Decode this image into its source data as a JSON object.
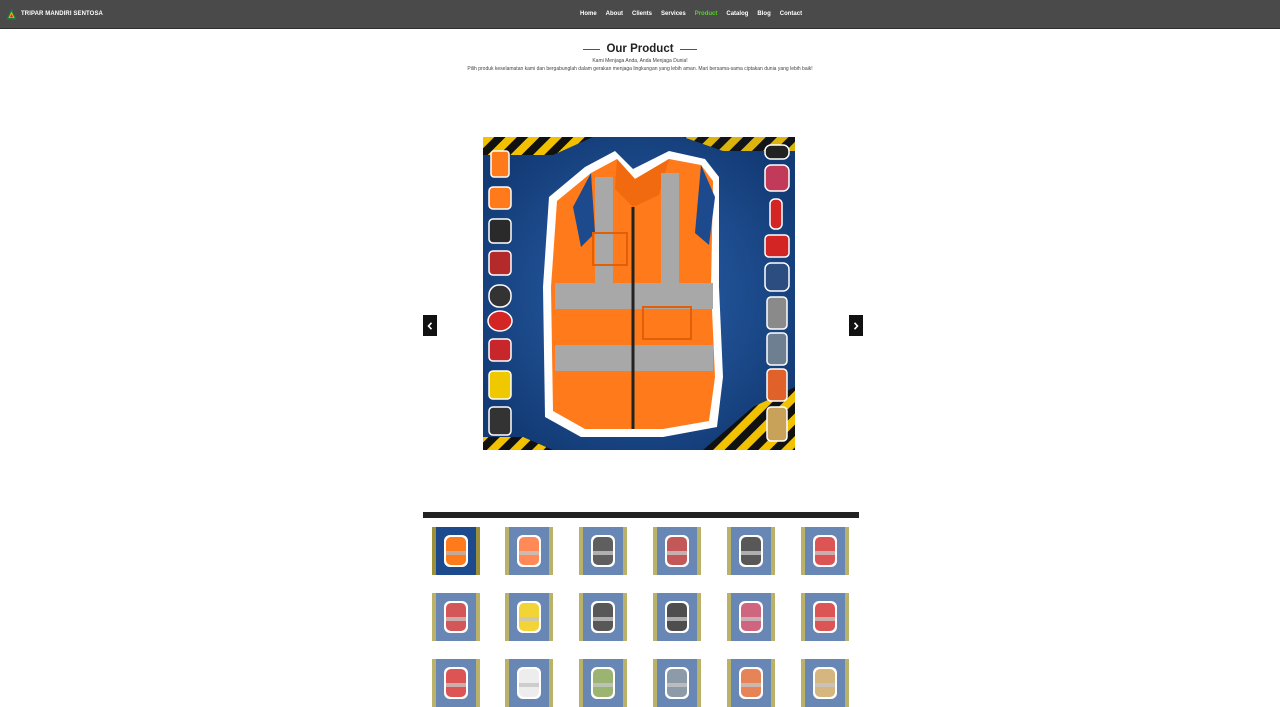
{
  "header": {
    "brand": "TRIPAR MANDIRI SENTOSA",
    "logo_icon": "triangle-logo-icon",
    "nav": [
      {
        "label": "Home",
        "active": false
      },
      {
        "label": "About",
        "active": false
      },
      {
        "label": "Clients",
        "active": false
      },
      {
        "label": "Services",
        "active": false
      },
      {
        "label": "Product",
        "active": true
      },
      {
        "label": "Catalog",
        "active": false
      },
      {
        "label": "Blog",
        "active": false
      },
      {
        "label": "Contact",
        "active": false
      }
    ],
    "active_color": "#55d12a"
  },
  "section": {
    "title": "Our Product",
    "tagline": "Kami Menjaga Anda, Anda Menjaga Dunia!",
    "description": "Pilih produk keselamatan kami dan bergabunglah dalam gerakan menjaga lingkungan yang lebih aman. Mari bersama-sama ciptakan dunia yang lebih baik!"
  },
  "carousel": {
    "prev_icon": "chevron-left-icon",
    "next_icon": "chevron-right-icon",
    "current_item": "safety-vest",
    "background_color": "#1c4a8c",
    "product_color": "#ff7a1a"
  },
  "thumbnails": [
    {
      "item": "safety-vest",
      "selected": true
    },
    {
      "item": "gloves",
      "selected": false
    },
    {
      "item": "work-gloves",
      "selected": false
    },
    {
      "item": "safety-shoes",
      "selected": false
    },
    {
      "item": "respirator",
      "selected": false
    },
    {
      "item": "safety-helmet",
      "selected": false
    },
    {
      "item": "face-shield",
      "selected": false
    },
    {
      "item": "boots",
      "selected": false
    },
    {
      "item": "work-boots",
      "selected": false
    },
    {
      "item": "goggles",
      "selected": false
    },
    {
      "item": "safety-glasses",
      "selected": false
    },
    {
      "item": "fire-extinguisher",
      "selected": false
    },
    {
      "item": "fire-extinguisher-set",
      "selected": false
    },
    {
      "item": "lanyard",
      "selected": false
    },
    {
      "item": "body-harness",
      "selected": false
    },
    {
      "item": "full-body-harness",
      "selected": false
    },
    {
      "item": "harness-orange",
      "selected": false
    },
    {
      "item": "fire-suit",
      "selected": false
    }
  ]
}
